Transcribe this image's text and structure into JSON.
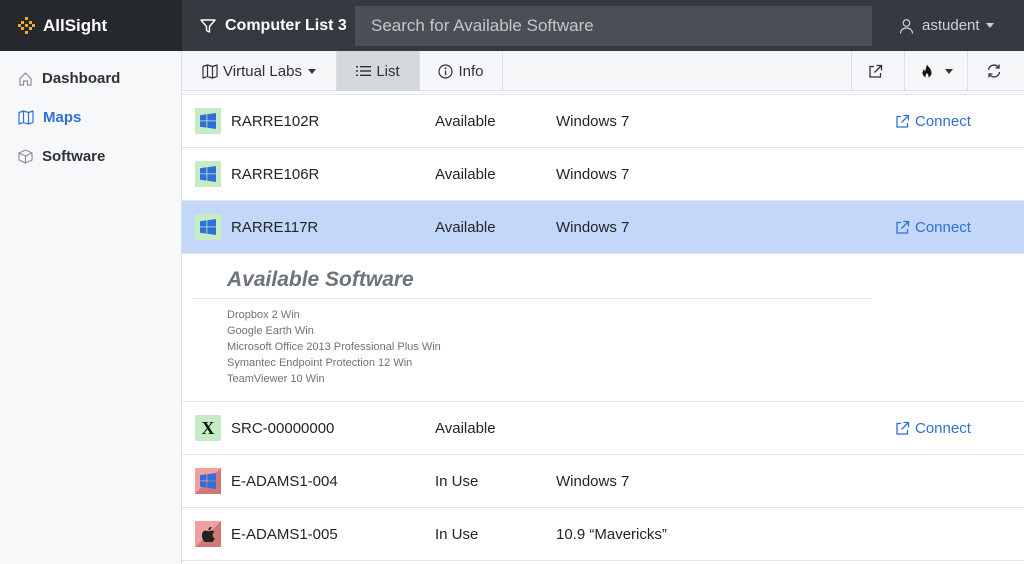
{
  "header": {
    "brand": "AllSight",
    "filter_label": "Computer List 3",
    "search_placeholder": "Search for Available Software",
    "user": "astudent"
  },
  "sidebar": {
    "items": [
      {
        "label": "Dashboard",
        "icon": "home-icon",
        "active": false
      },
      {
        "label": "Maps",
        "icon": "map-icon",
        "active": true
      },
      {
        "label": "Software",
        "icon": "box-icon",
        "active": false
      }
    ]
  },
  "toolbar": {
    "location_label": "Virtual Labs",
    "list_label": "List",
    "info_label": "Info",
    "active_tab": "List"
  },
  "computers": [
    {
      "name": "RARRE102R",
      "status": "Available",
      "os": "Windows 7",
      "os_type": "windows",
      "connect": "Connect"
    },
    {
      "name": "RARRE106R",
      "status": "Available",
      "os": "Windows 7",
      "os_type": "windows",
      "connect": ""
    },
    {
      "name": "RARRE117R",
      "status": "Available",
      "os": "Windows 7",
      "os_type": "windows",
      "connect": "Connect",
      "selected": true
    },
    {
      "name": "SRC-00000000",
      "status": "Available",
      "os": "",
      "os_type": "x",
      "connect": "Connect"
    },
    {
      "name": "E-ADAMS1-004",
      "status": "In Use",
      "os": "Windows 7",
      "os_type": "windows",
      "connect": ""
    },
    {
      "name": "E-ADAMS1-005",
      "status": "In Use",
      "os": "10.9 “Mavericks”",
      "os_type": "apple",
      "connect": ""
    }
  ],
  "details": {
    "title": "Available Software",
    "software": [
      "Dropbox 2 Win",
      "Google Earth Win",
      "Microsoft Office 2013 Professional Plus Win",
      "Symantec Endpoint Protection 12 Win",
      "TeamViewer 10 Win"
    ]
  },
  "colors": {
    "accent": "#2f6fd6",
    "selected_row": "#c3d7f8",
    "available": "#c5ecc5",
    "in_use": "#e08c8c",
    "topbar": "#343a40"
  }
}
